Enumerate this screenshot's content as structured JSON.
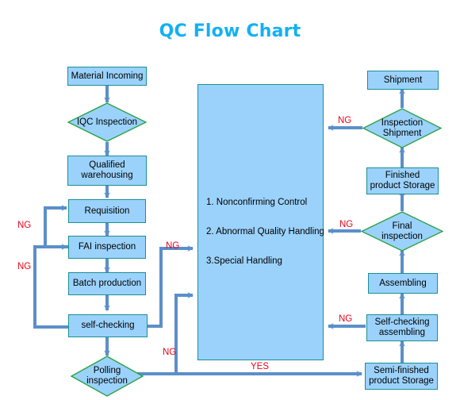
{
  "title": "QC Flow Chart",
  "colors": {
    "title": "#13b0f5",
    "node_fill": "#9bd2fb",
    "node_border": "#1a8f96",
    "diamond_border": "#2aa148",
    "connector": "#5b8fc9",
    "edge_label": "#e8051b",
    "background": "#ffffff"
  },
  "nodes": {
    "material_incoming": {
      "label": "Material Incoming",
      "shape": "process"
    },
    "iqc_inspection": {
      "label": "IQC Inspection",
      "shape": "decision"
    },
    "qualified_warehousing": {
      "label": "Qualified\nwarehousing",
      "shape": "process"
    },
    "requisition": {
      "label": "Requisition",
      "shape": "process"
    },
    "fai_inspection": {
      "label": "FAI inspection",
      "shape": "process"
    },
    "batch_production": {
      "label": "Batch production",
      "shape": "process"
    },
    "self_checking": {
      "label": "self-checking",
      "shape": "process"
    },
    "polling_inspection": {
      "label": "Polling\ninspection",
      "shape": "decision"
    },
    "semi_finished_storage": {
      "label": "Semi-finished\nproduct Storage",
      "shape": "process"
    },
    "self_checking_assembling": {
      "label": "Self-checking\nassembling",
      "shape": "process"
    },
    "assembling": {
      "label": "Assembling",
      "shape": "process"
    },
    "final_inspection": {
      "label": "Final\ninspection",
      "shape": "decision"
    },
    "finished_product_storage": {
      "label": "Finished\nproduct Storage",
      "shape": "process"
    },
    "inspection_shipment": {
      "label": "Inspection\nShipment",
      "shape": "decision"
    },
    "shipment": {
      "label": "Shipment",
      "shape": "process"
    }
  },
  "central_box": {
    "items": [
      "1. Nonconfirming Control",
      "2. Abnormal Quality Handling",
      "3.Special Handling"
    ]
  },
  "edge_labels": {
    "ng_requisition": "NG",
    "ng_fai": "NG",
    "ng_self_checking": "NG",
    "ng_polling": "NG",
    "ng_self_checking_assembling": "NG",
    "ng_final_inspection": "NG",
    "ng_inspection_shipment": "NG",
    "yes_polling": "YES"
  }
}
